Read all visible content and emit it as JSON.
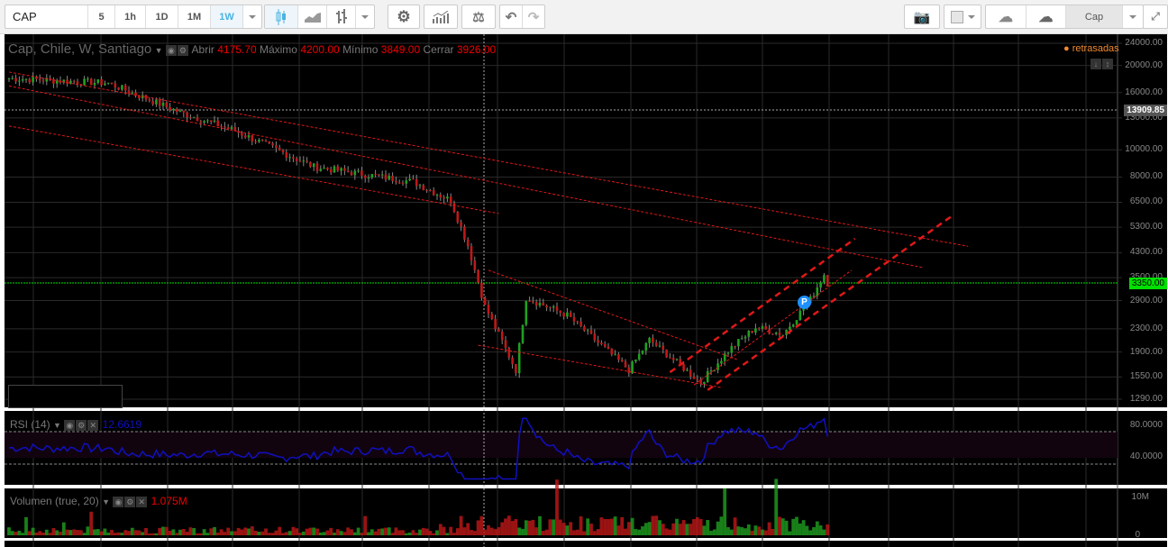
{
  "toolbar": {
    "symbol": "CAP",
    "intervals": [
      "5",
      "1h",
      "1D",
      "1M",
      "1W"
    ],
    "active_interval": "1W",
    "layout_name": "Cap",
    "icons": [
      "candles-icon",
      "area-chart-icon",
      "bars-icon",
      "gear-icon",
      "indicators-icon",
      "compare-icon",
      "undo-icon",
      "redo-icon",
      "camera-icon",
      "color-box-icon",
      "cloud-download-icon",
      "cloud-upload-icon",
      "fullscreen-icon"
    ]
  },
  "main": {
    "title": "Cap, Chile, W, Santiago",
    "ohlc": {
      "open_label": "Abrir",
      "open": "4175.70",
      "high_label": "Máximo",
      "high": "4200.00",
      "low_label": "Mínimo",
      "low": "3849.00",
      "close_label": "Cerrar",
      "close": "3926.00"
    },
    "delayed_label": "retrasadas",
    "price_axis": [
      "24000.00",
      "20000.00",
      "16000.00",
      "13000.00",
      "10000.00",
      "8000.00",
      "6500.00",
      "5300.00",
      "4300.00",
      "3500.00",
      "2900.00",
      "2300.00",
      "1900.00",
      "1550.00",
      "1290.00"
    ],
    "crosshair_price": "13909.85",
    "last_price": "3350.00",
    "marker_label": "P",
    "colors": {
      "up": "#1fa01f",
      "down": "#c01818",
      "trend": "#e01818",
      "last": "#00e000",
      "rsi": "#1010c0"
    }
  },
  "rsi": {
    "title": "RSI (14)",
    "value": "12.6619",
    "axis": [
      "80.0000",
      "40.0000"
    ]
  },
  "volume": {
    "title": "Volumen (true, 20)",
    "value": "1.075M",
    "axis": [
      "10M",
      "0"
    ]
  },
  "chart_data": {
    "type": "candlestick",
    "scale": "log",
    "ylim": [
      1290,
      24000
    ],
    "close_keypoints": [
      [
        0,
        18000
      ],
      [
        29,
        17300
      ],
      [
        50,
        13600
      ],
      [
        66,
        11700
      ],
      [
        89,
        8700
      ],
      [
        118,
        7700
      ],
      [
        129,
        6600
      ],
      [
        134,
        4560
      ],
      [
        139,
        2760
      ],
      [
        148,
        1640
      ],
      [
        151,
        2970
      ],
      [
        163,
        2570
      ],
      [
        181,
        1640
      ],
      [
        187,
        2100
      ],
      [
        202,
        1480
      ],
      [
        210,
        1920
      ],
      [
        218,
        2330
      ],
      [
        226,
        2200
      ],
      [
        234,
        2930
      ],
      [
        238,
        3600
      ],
      [
        239,
        3350
      ]
    ],
    "trendlines": [
      {
        "style": "thin",
        "from": [
          0,
          18950
        ],
        "to": [
          280,
          4530
        ]
      },
      {
        "style": "thin",
        "from": [
          0,
          16900
        ],
        "to": [
          267,
          3800
        ]
      },
      {
        "style": "thin",
        "from": [
          0,
          12160
        ],
        "to": [
          143,
          5930
        ]
      },
      {
        "style": "thin",
        "from": [
          140,
          3720
        ],
        "to": [
          213,
          1780
        ]
      },
      {
        "style": "thin",
        "from": [
          137,
          2010
        ],
        "to": [
          208,
          1420
        ]
      },
      {
        "style": "thin",
        "from": [
          200,
          1450
        ],
        "to": [
          246,
          3720
        ]
      },
      {
        "style": "bold",
        "from": [
          193,
          1610
        ],
        "to": [
          247,
          4820
        ]
      },
      {
        "style": "bold",
        "from": [
          204,
          1390
        ],
        "to": [
          276,
          5890
        ]
      }
    ]
  }
}
